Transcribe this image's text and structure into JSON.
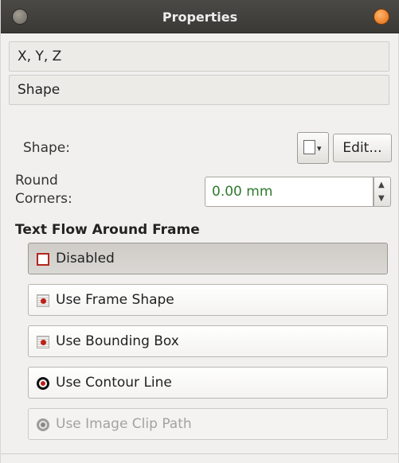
{
  "window": {
    "title": "Properties"
  },
  "sections": {
    "xyz": {
      "label": "X, Y, Z"
    },
    "shape": {
      "label": "Shape"
    }
  },
  "shape_row": {
    "label": "Shape:",
    "shape_button_icon": "frame-shape-dropdown-icon",
    "edit_label": "Edit..."
  },
  "round_corners": {
    "label_line1": "Round",
    "label_line2": "Corners:",
    "value": "0.00 mm"
  },
  "text_flow": {
    "title": "Text Flow Around Frame",
    "options": [
      {
        "label": "Disabled",
        "state": "pressed",
        "icon": "disabled-box-icon"
      },
      {
        "label": "Use Frame Shape",
        "state": "normal",
        "icon": "frame-shape-icon"
      },
      {
        "label": "Use Bounding Box",
        "state": "normal",
        "icon": "bounding-box-icon"
      },
      {
        "label": "Use Contour Line",
        "state": "normal",
        "icon": "contour-line-icon"
      },
      {
        "label": "Use Image Clip Path",
        "state": "disabled",
        "icon": "image-clip-path-icon"
      }
    ]
  },
  "colors": {
    "accent_orange": "#e06a10",
    "value_green": "#2f7a2f",
    "radio_red": "#c0201a"
  }
}
